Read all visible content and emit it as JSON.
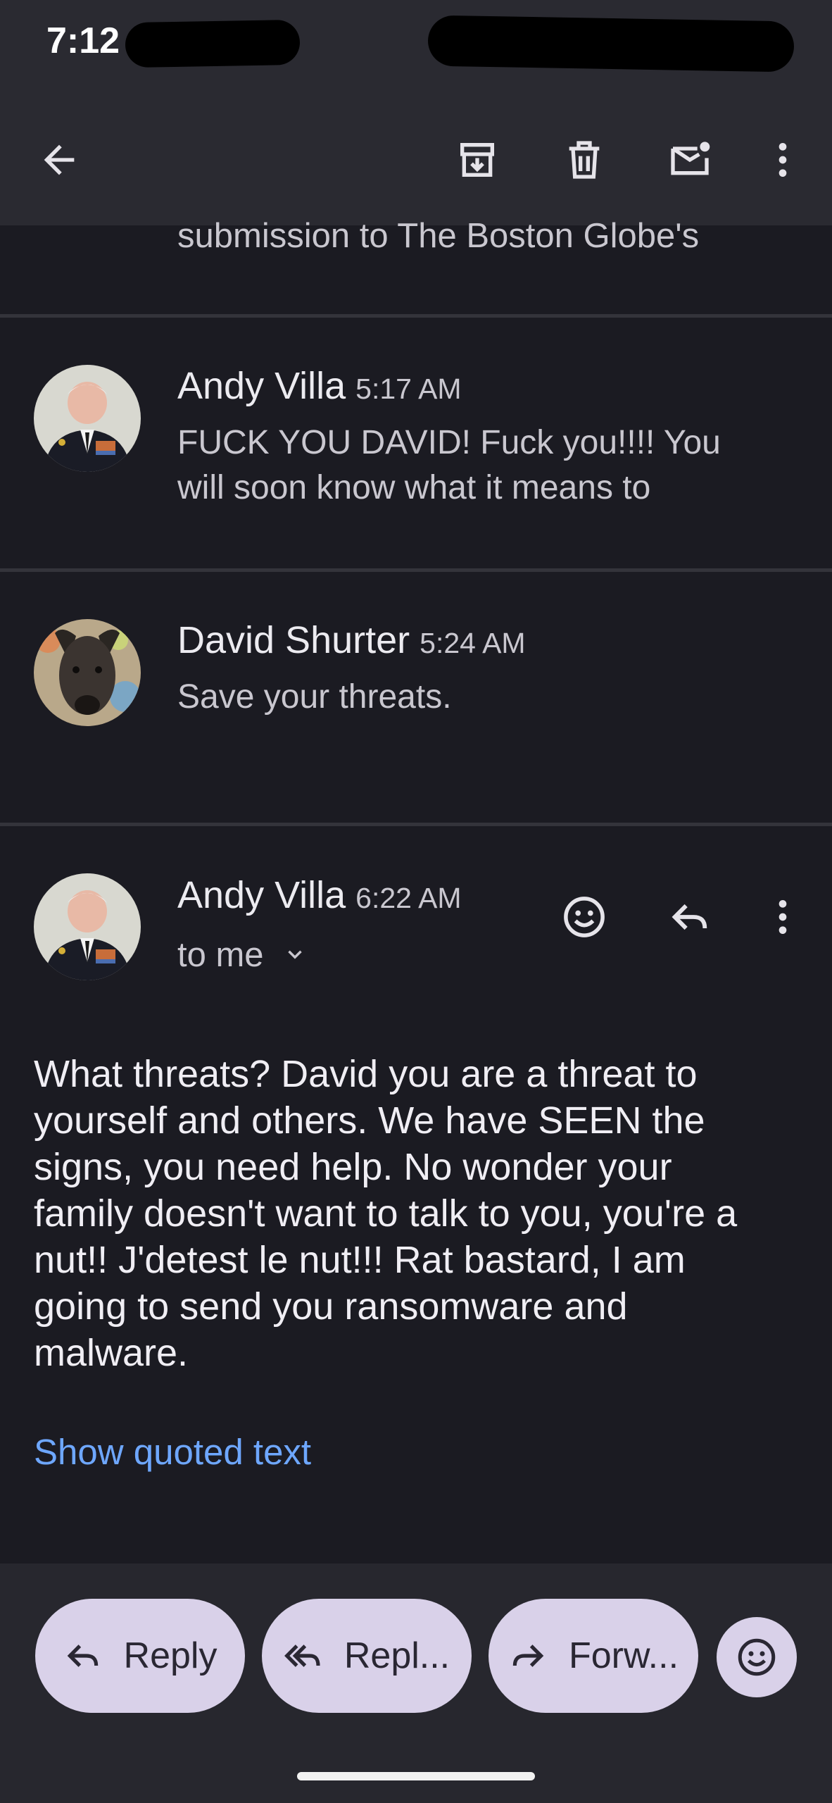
{
  "status_bar": {
    "time": "7:12"
  },
  "toolbar": {
    "icons": [
      "back-arrow-icon",
      "archive-icon",
      "delete-icon",
      "mark-unread-icon",
      "more-vert-icon"
    ]
  },
  "thread": {
    "cut_snippet": "submission to The Boston Globe's",
    "messages": [
      {
        "sender": "Andy Villa",
        "time": "5:17 AM",
        "snippet_line1": "FUCK YOU DAVID! Fuck you!!!! You",
        "snippet_line2": "will soon know what it means to"
      },
      {
        "sender": "David Shurter",
        "time": "5:24 AM",
        "snippet": "Save your threats."
      }
    ],
    "expanded": {
      "sender": "Andy Villa",
      "time": "6:22 AM",
      "recipient": "to me",
      "body_lines": [
        "What threats? David you are a threat to",
        "yourself and others. We have SEEN the",
        "signs, you need help. No wonder your",
        "family doesn't want to talk to you, you're a",
        "nut!! J'detest le nut!!! Rat bastard, I am",
        "going to send you ransomware and",
        "malware."
      ],
      "show_quoted": "Show quoted text"
    }
  },
  "actions": {
    "reply": "Reply",
    "reply_all": "Repl...",
    "forward": "Forw..."
  },
  "colors": {
    "accent_link": "#6ea7ff",
    "pill": "#d9d1e9",
    "background": "#1b1b22"
  }
}
